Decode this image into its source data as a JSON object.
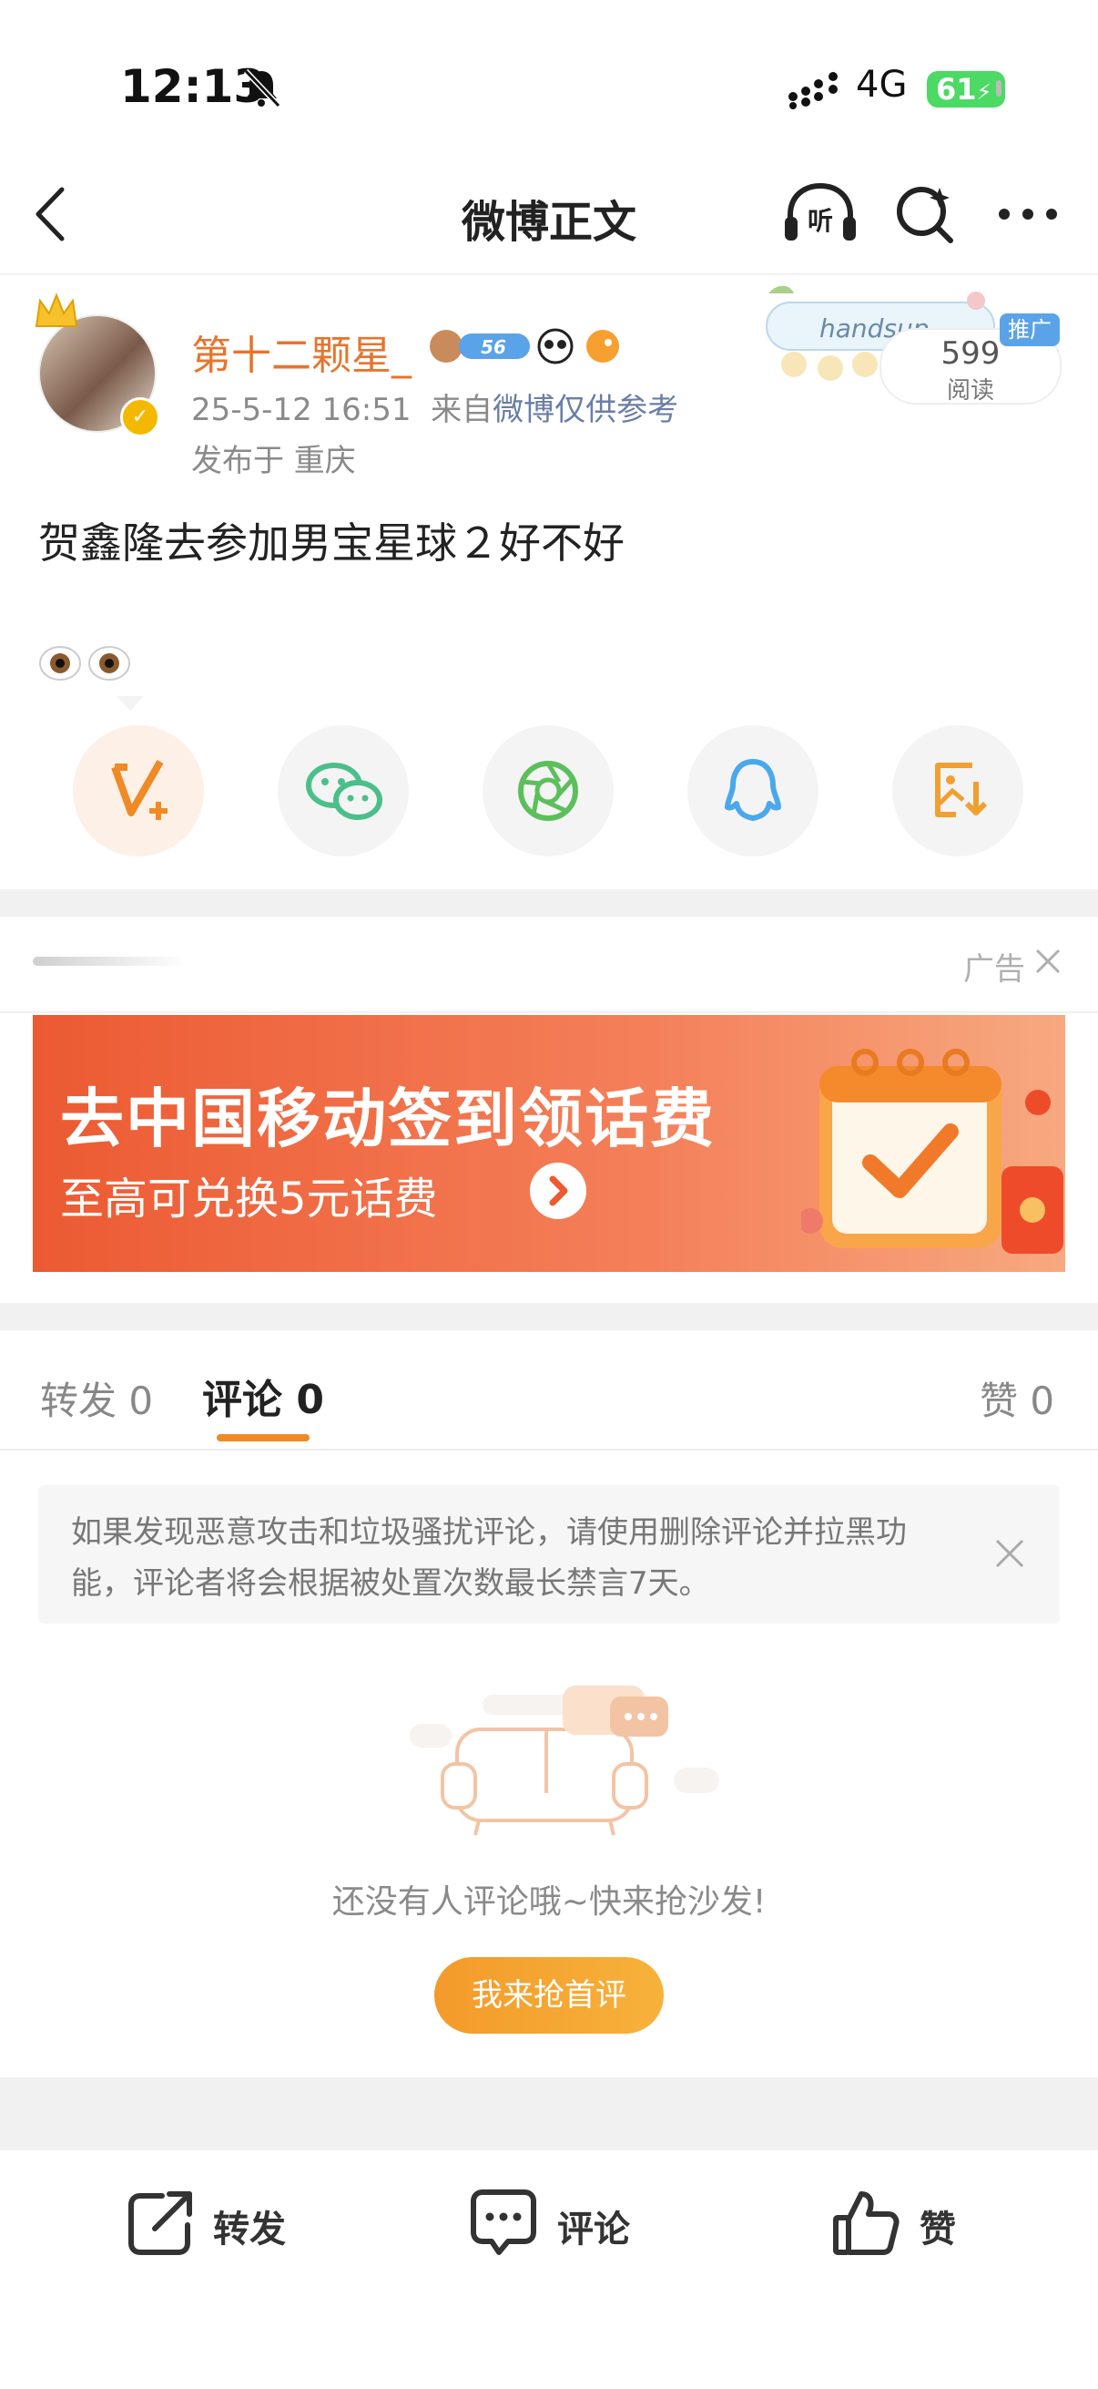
{
  "status_bar": {
    "time": "12:13",
    "network": "4G",
    "battery": "61"
  },
  "nav": {
    "title": "微博正文",
    "listen_label": "听"
  },
  "post": {
    "author": "第十二颗星_",
    "level_badge": "56",
    "timestamp": "25-5-12 16:51",
    "source_prefix": "来自",
    "source": "微博仅供参考",
    "location": "发布于 重庆",
    "text": "贺鑫隆去参加男宝星球２好不好",
    "emoji": "👀👀",
    "reads": "599",
    "reads_label": "阅读",
    "promo_label": "推广",
    "promo_sticker_text": "handsup"
  },
  "share_targets": [
    "vplus-icon",
    "wechat-icon",
    "moments-icon",
    "qq-icon",
    "save-image-icon"
  ],
  "ad": {
    "label": "广告",
    "title": "去中国移动签到领话费",
    "subtitle": "至高可兑换5元话费"
  },
  "tabs": {
    "repost": "转发",
    "repost_count": "0",
    "comment": "评论",
    "comment_count": "0",
    "like": "赞",
    "like_count": "0"
  },
  "notice": "如果发现恶意攻击和垃圾骚扰评论，请使用删除评论并拉黑功能，评论者将会根据被处置次数最长禁言7天。",
  "empty": {
    "text": "还没有人评论哦~快来抢沙发!",
    "button": "我来抢首评"
  },
  "toolbar": {
    "repost": "转发",
    "comment": "评论",
    "like": "赞"
  },
  "colors": {
    "accent": "#f08a24",
    "username": "#e8742c",
    "link": "#6a7ea6"
  }
}
